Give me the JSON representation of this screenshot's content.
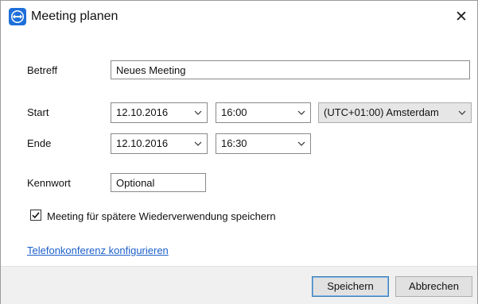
{
  "window": {
    "title": "Meeting planen",
    "close_glyph": "✕",
    "app_icon": "teamviewer-icon"
  },
  "form": {
    "subject_label": "Betreff",
    "subject_value": "Neues Meeting",
    "start_label": "Start",
    "start_date": "12.10.2016",
    "start_time": "16:00",
    "timezone": "(UTC+01:00) Amsterdam",
    "end_label": "Ende",
    "end_date": "12.10.2016",
    "end_time": "16:30",
    "password_label": "Kennwort",
    "password_placeholder": "Optional",
    "save_for_reuse_label": "Meeting für spätere Wiederverwendung speichern",
    "save_for_reuse_checked": true,
    "conference_link": "Telefonkonferenz konfigurieren"
  },
  "footer": {
    "save_label": "Speichern",
    "cancel_label": "Abbrechen"
  },
  "colors": {
    "accent": "#1e6fd9",
    "link": "#1c5fc9",
    "footer_bg": "#f0f0f0"
  }
}
